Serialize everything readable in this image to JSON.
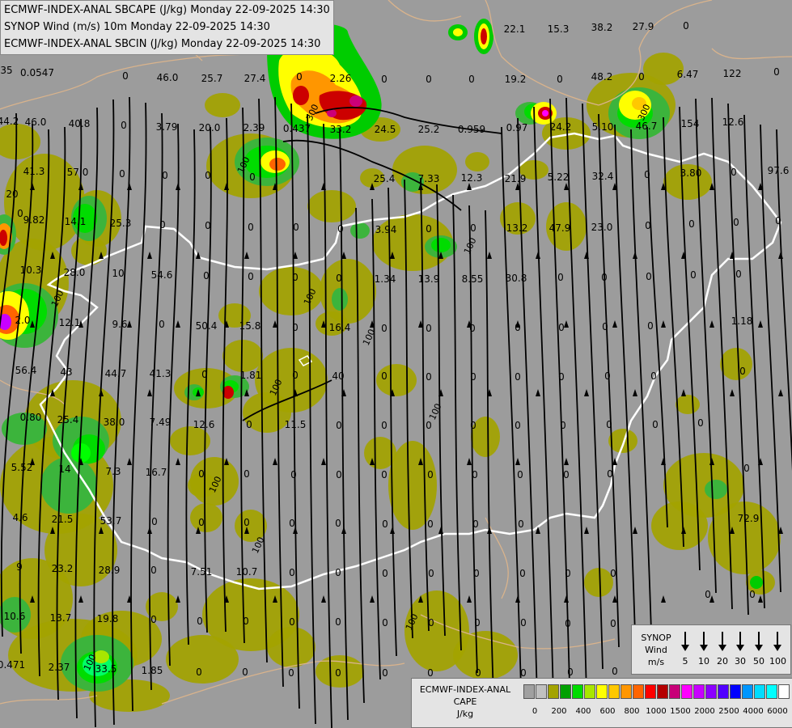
{
  "header": {
    "line1": "ECMWF-INDEX-ANAL SBCAPE (J/kg) Monday 22-09-2025 14:30",
    "line2": "SYNOP Wind (m/s) 10m Monday 22-09-2025 14:30",
    "line3": "ECMWF-INDEX-ANAL SBCIN (J/kg) Monday 22-09-2025 14:30"
  },
  "colors": {
    "background": "#9c9c9c",
    "cape_low": "#a3a300",
    "cape_green": "#3cb43c",
    "cape_bright_green": "#00dc00",
    "border": "#ffffff",
    "outline": "#d9b38c",
    "streamline": "#000000"
  },
  "wind_legend": {
    "title": [
      "SYNOP",
      "Wind",
      "m/s"
    ],
    "items": [
      {
        "label": "5",
        "icon": "wind-barb-icon"
      },
      {
        "label": "10",
        "icon": "wind-barb-icon"
      },
      {
        "label": "20",
        "icon": "wind-barb-icon"
      },
      {
        "label": "30",
        "icon": "wind-barb-icon"
      },
      {
        "label": "50",
        "icon": "wind-barb-icon"
      },
      {
        "label": "100",
        "icon": "wind-barb-icon"
      }
    ]
  },
  "cape_legend": {
    "title": [
      "ECMWF-INDEX-ANAL",
      "CAPE",
      "J/kg"
    ],
    "colors": [
      "#a0a0a0",
      "#c0c0c0",
      "#a3a300",
      "#00a000",
      "#00dc00",
      "#a8e600",
      "#ffff00",
      "#ffc800",
      "#ff9600",
      "#ff6400",
      "#ff0000",
      "#b40000",
      "#c80078",
      "#ff00ff",
      "#c800ff",
      "#8c00ff",
      "#5000ff",
      "#0000ff",
      "#0096ff",
      "#00dcff",
      "#00ffff",
      "#ffffff"
    ],
    "ticks": [
      "0",
      "200",
      "400",
      "600",
      "800",
      "1000",
      "1500",
      "2000",
      "2500",
      "4000",
      "6000"
    ]
  },
  "values": [
    {
      "t": "35"
    },
    {
      "t": "0.0547"
    },
    {
      "t": "0"
    },
    {
      "t": "46.0"
    },
    {
      "t": "25.7"
    },
    {
      "t": "27.4"
    },
    {
      "t": "0"
    },
    {
      "t": "2.26"
    },
    {
      "t": "0"
    },
    {
      "t": "0"
    },
    {
      "t": "0"
    },
    {
      "t": "19.2"
    },
    {
      "t": "0"
    },
    {
      "t": "48.2"
    },
    {
      "t": "0"
    },
    {
      "t": "6.47"
    },
    {
      "t": "122"
    },
    {
      "t": "0"
    },
    {
      "t": "44.2"
    },
    {
      "t": "46.0"
    },
    {
      "t": "40.8"
    },
    {
      "t": "0"
    },
    {
      "t": "3.79"
    },
    {
      "t": "20.0"
    },
    {
      "t": "2.39"
    },
    {
      "t": "0.437"
    },
    {
      "t": "33.2"
    },
    {
      "t": "24.5"
    },
    {
      "t": "25.2"
    },
    {
      "t": "0.959"
    },
    {
      "t": "0.97"
    },
    {
      "t": "24.2"
    },
    {
      "t": "5.10"
    },
    {
      "t": "46.7"
    },
    {
      "t": "154"
    },
    {
      "t": "12.6"
    },
    {
      "t": "41.3"
    },
    {
      "t": "57.0"
    },
    {
      "t": "0"
    },
    {
      "t": "0"
    },
    {
      "t": "0"
    },
    {
      "t": "0"
    },
    {
      "t": "25.4"
    },
    {
      "t": "7.33"
    },
    {
      "t": "12.3"
    },
    {
      "t": "21.9"
    },
    {
      "t": "5.22"
    },
    {
      "t": "32.4"
    },
    {
      "t": "0"
    },
    {
      "t": "3.80"
    },
    {
      "t": "0"
    },
    {
      "t": "97.6"
    },
    {
      "t": "20"
    },
    {
      "t": "9.82"
    },
    {
      "t": "14.1"
    },
    {
      "t": "25.3"
    },
    {
      "t": "0"
    },
    {
      "t": "0"
    },
    {
      "t": "0"
    },
    {
      "t": "0"
    },
    {
      "t": "0"
    },
    {
      "t": "3.94"
    },
    {
      "t": "0"
    },
    {
      "t": "0"
    },
    {
      "t": "13.2"
    },
    {
      "t": "47.9"
    },
    {
      "t": "23.0"
    },
    {
      "t": "0"
    },
    {
      "t": "0"
    },
    {
      "t": "0"
    },
    {
      "t": "0"
    },
    {
      "t": "0"
    },
    {
      "t": "10.3"
    },
    {
      "t": "28.0"
    },
    {
      "t": "10"
    },
    {
      "t": "54.6"
    },
    {
      "t": "0"
    },
    {
      "t": "0"
    },
    {
      "t": "0"
    },
    {
      "t": "0"
    },
    {
      "t": "1.34"
    },
    {
      "t": "13.9"
    },
    {
      "t": "8.55"
    },
    {
      "t": "30.8"
    },
    {
      "t": "0"
    },
    {
      "t": "0"
    },
    {
      "t": "0"
    },
    {
      "t": "0"
    },
    {
      "t": "0"
    },
    {
      "t": "2.0"
    },
    {
      "t": "12.1"
    },
    {
      "t": "9.6"
    },
    {
      "t": "0"
    },
    {
      "t": "50.4"
    },
    {
      "t": "15.8"
    },
    {
      "t": "0"
    },
    {
      "t": "16.4"
    },
    {
      "t": "0"
    },
    {
      "t": "0"
    },
    {
      "t": "0"
    },
    {
      "t": "0"
    },
    {
      "t": "0"
    },
    {
      "t": "0"
    },
    {
      "t": "0"
    },
    {
      "t": "1.18"
    },
    {
      "t": "56.4"
    },
    {
      "t": "43"
    },
    {
      "t": "44.7"
    },
    {
      "t": "41.3"
    },
    {
      "t": "0"
    },
    {
      "t": "1.81"
    },
    {
      "t": "0"
    },
    {
      "t": "40"
    },
    {
      "t": "0"
    },
    {
      "t": "0"
    },
    {
      "t": "0"
    },
    {
      "t": "0"
    },
    {
      "t": "0"
    },
    {
      "t": "0"
    },
    {
      "t": "0"
    },
    {
      "t": "0"
    },
    {
      "t": "0.80"
    },
    {
      "t": "25.4"
    },
    {
      "t": "38.0"
    },
    {
      "t": "7.49"
    },
    {
      "t": "12.6"
    },
    {
      "t": "0"
    },
    {
      "t": "11.5"
    },
    {
      "t": "0"
    },
    {
      "t": "0"
    },
    {
      "t": "0"
    },
    {
      "t": "0"
    },
    {
      "t": "0"
    },
    {
      "t": "0"
    },
    {
      "t": "0"
    },
    {
      "t": "0"
    },
    {
      "t": "0"
    },
    {
      "t": "5.52"
    },
    {
      "t": "14"
    },
    {
      "t": "7.3"
    },
    {
      "t": "16.7"
    },
    {
      "t": "0"
    },
    {
      "t": "0"
    },
    {
      "t": "0"
    },
    {
      "t": "0"
    },
    {
      "t": "0"
    },
    {
      "t": "0"
    },
    {
      "t": "0"
    },
    {
      "t": "0"
    },
    {
      "t": "0"
    },
    {
      "t": "0"
    },
    {
      "t": "0"
    },
    {
      "t": "4.6"
    },
    {
      "t": "21.5"
    },
    {
      "t": "53.7"
    },
    {
      "t": "0"
    },
    {
      "t": "0"
    },
    {
      "t": "0"
    },
    {
      "t": "0"
    },
    {
      "t": "0"
    },
    {
      "t": "0"
    },
    {
      "t": "0"
    },
    {
      "t": "0"
    },
    {
      "t": "0"
    },
    {
      "t": "72.9"
    },
    {
      "t": "9"
    },
    {
      "t": "23.2"
    },
    {
      "t": "28.9"
    },
    {
      "t": "0"
    },
    {
      "t": "7.51"
    },
    {
      "t": "10.7"
    },
    {
      "t": "0"
    },
    {
      "t": "0"
    },
    {
      "t": "0"
    },
    {
      "t": "0"
    },
    {
      "t": "0"
    },
    {
      "t": "0"
    },
    {
      "t": "0"
    },
    {
      "t": "0"
    },
    {
      "t": "10.6"
    },
    {
      "t": "13.7"
    },
    {
      "t": "19.8"
    },
    {
      "t": "0"
    },
    {
      "t": "0"
    },
    {
      "t": "0"
    },
    {
      "t": "0"
    },
    {
      "t": "0"
    },
    {
      "t": "0"
    },
    {
      "t": "0"
    },
    {
      "t": "0"
    },
    {
      "t": "0"
    },
    {
      "t": "0"
    },
    {
      "t": "0"
    },
    {
      "t": "0.471"
    },
    {
      "t": "2.37"
    },
    {
      "t": "33.5"
    },
    {
      "t": "1.85"
    },
    {
      "t": "0"
    },
    {
      "t": "0"
    },
    {
      "t": "0"
    },
    {
      "t": "0"
    },
    {
      "t": "0"
    },
    {
      "t": "0"
    },
    {
      "t": "0"
    },
    {
      "t": "0"
    },
    {
      "t": "0"
    },
    {
      "t": "0"
    },
    {
      "t": "22.1"
    },
    {
      "t": "15.3"
    },
    {
      "t": "38.2"
    },
    {
      "t": "27.9"
    },
    {
      "t": "0"
    },
    {
      "t": "4.2"
    },
    {
      "t": "0"
    },
    {
      "t": "0"
    },
    {
      "t": "0"
    },
    {
      "t": "0"
    }
  ],
  "contour_labels": [
    "100",
    "100",
    "100",
    "100",
    "100",
    "100",
    "100",
    "100",
    "100",
    "100",
    "100",
    "300",
    "300"
  ]
}
